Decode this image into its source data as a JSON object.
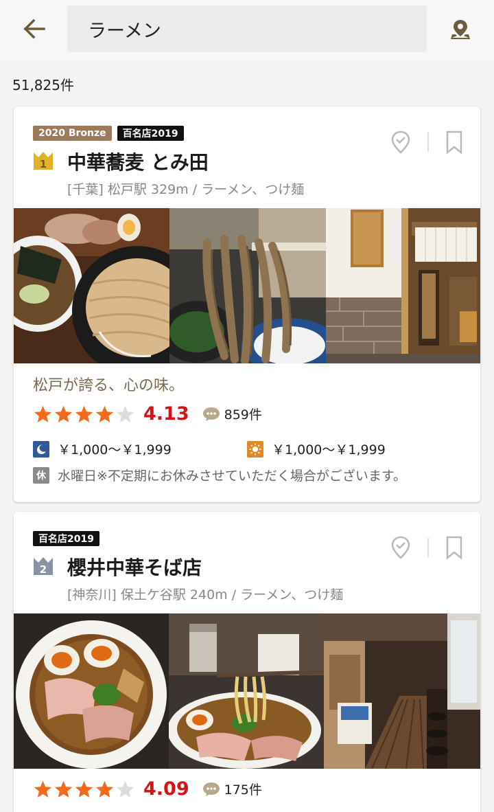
{
  "search": {
    "query": "ラーメン"
  },
  "result_count": "51,825件",
  "restaurants": [
    {
      "badges": [
        "2020 Bronze",
        "百名店2019"
      ],
      "rank": "1",
      "name": "中華蕎麦 とみ田",
      "area": "[千葉] 松戸駅 329m / ラーメン、つけ麺",
      "catch": "松戸が誇る、心の味。",
      "rating": 4.13,
      "rating_text": "4.13",
      "reviews": "859件",
      "dinner_price": "￥1,000〜￥1,999",
      "lunch_price": "￥1,000〜￥1,999",
      "holiday_label": "休",
      "holiday": "水曜日※不定期にお休みさせていただく場合がございます。"
    },
    {
      "badges": [
        "百名店2019"
      ],
      "rank": "2",
      "name": "櫻井中華そば店",
      "area": "[神奈川] 保土ケ谷駅 240m / ラーメン、つけ麺",
      "rating": 4.09,
      "rating_text": "4.09",
      "reviews": "175件"
    }
  ],
  "icons": {
    "back": "arrow-left-icon",
    "map": "map-pin-icon",
    "visited": "check-pin-icon",
    "bookmark": "bookmark-icon",
    "dinner": "moon-icon",
    "lunch": "sun-icon",
    "reviews": "speech-bubble-icon"
  },
  "colors": {
    "accent_icon": "#6b5d3c",
    "star": "#f36a1a",
    "score": "#d21414",
    "bronze": "#9b7b5c"
  }
}
